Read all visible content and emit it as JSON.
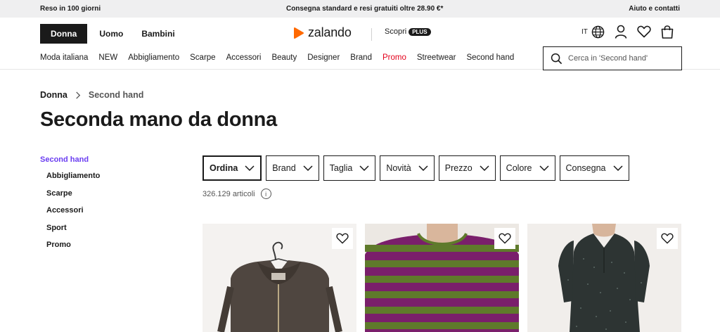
{
  "topbar": {
    "left": "Reso in 100 giorni",
    "center": "Consegna standard e resi gratuiti oltre 28.90 €*",
    "right": "Aiuto e contatti"
  },
  "header": {
    "gender_tabs": [
      "Donna",
      "Uomo",
      "Bambini"
    ],
    "logo": "zalando",
    "scopri": "Scopri",
    "plus": "PLUS",
    "language": "IT"
  },
  "nav": {
    "items": [
      "Moda italiana",
      "NEW",
      "Abbigliamento",
      "Scarpe",
      "Accessori",
      "Beauty",
      "Designer",
      "Brand",
      "Promo",
      "Streetwear",
      "Second hand"
    ]
  },
  "search": {
    "placeholder": "Cerca in 'Second hand'"
  },
  "breadcrumb": [
    "Donna",
    "Second hand"
  ],
  "page_title": "Seconda mano da donna",
  "sidebar": {
    "section": "Second hand",
    "items": [
      "Abbigliamento",
      "Scarpe",
      "Accessori",
      "Sport",
      "Promo"
    ]
  },
  "filters": [
    "Ordina",
    "Brand",
    "Taglia",
    "Novità",
    "Prezzo",
    "Colore",
    "Consegna"
  ],
  "result_count": "326.129 articoli",
  "colors": {
    "accent_purple": "#6a3df1",
    "promo_red": "#e3001b",
    "logo_orange": "#ff6900"
  },
  "products": [
    {
      "image": "brown-zip-hoodie-on-hanger"
    },
    {
      "image": "green-purple-striped-top"
    },
    {
      "image": "dark-patterned-dress"
    }
  ]
}
